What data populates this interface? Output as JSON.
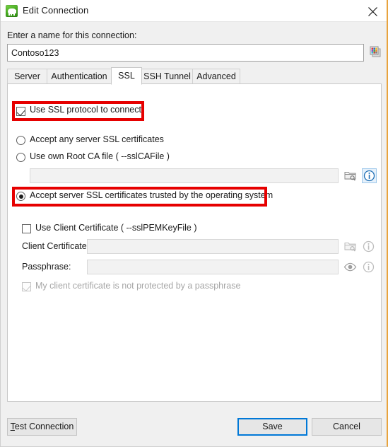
{
  "window": {
    "title": "Edit Connection",
    "app_icon": "elephant-green-icon",
    "close_icon": "close-icon",
    "accent_border_color": "#e8a33d"
  },
  "connection_name": {
    "label": "Enter a name for this connection:",
    "value": "Contoso123",
    "placeholder": "",
    "palette_icon": "color-palette-icon"
  },
  "tabs": [
    {
      "label": "Server",
      "active": false
    },
    {
      "label": "Authentication",
      "active": false
    },
    {
      "label": "SSL",
      "active": true
    },
    {
      "label": "SSH Tunnel",
      "active": false
    },
    {
      "label": "Advanced",
      "active": false
    }
  ],
  "ssl": {
    "use_ssl": {
      "label": "Use SSL protocol to connect",
      "checked": true,
      "highlighted": true
    },
    "mode_options": [
      {
        "label": "Accept any server SSL certificates",
        "selected": false,
        "highlighted": false
      },
      {
        "label": "Use own Root CA file ( --sslCAFile )",
        "selected": false,
        "highlighted": false
      },
      {
        "label": "Accept server SSL certificates trusted by the operating system",
        "selected": true,
        "highlighted": true
      }
    ],
    "ca_file": {
      "value": "",
      "placeholder": "",
      "browse_icon": "folder-browse-icon",
      "info_icon": "info-icon",
      "info_icon_state": "hovered"
    },
    "client_certificate": {
      "use_client_cert": {
        "label": "Use Client Certificate ( --sslPEMKeyFile )",
        "checked": false
      },
      "cert_field": {
        "label": "Client Certificate:",
        "value": "",
        "placeholder": "",
        "browse_icon": "folder-browse-icon",
        "info_icon": "info-icon",
        "disabled": true
      },
      "passphrase_field": {
        "label": "Passphrase:",
        "value": "",
        "placeholder": "",
        "reveal_icon": "eye-icon",
        "info_icon": "info-icon",
        "disabled": true
      },
      "no_passphrase": {
        "label": "My client certificate is not protected by a passphrase",
        "checked": true,
        "disabled": true
      }
    }
  },
  "footer": {
    "test_connection": {
      "label": "Test Connection",
      "accel": "T",
      "rest": "est Connection"
    },
    "save": {
      "label": "Save",
      "focused": true
    },
    "cancel": {
      "label": "Cancel"
    }
  },
  "colors": {
    "highlight_red": "#e60000",
    "focus_blue": "#0078d7",
    "dialog_gray": "#f0f0f0",
    "panel_white": "#ffffff"
  }
}
